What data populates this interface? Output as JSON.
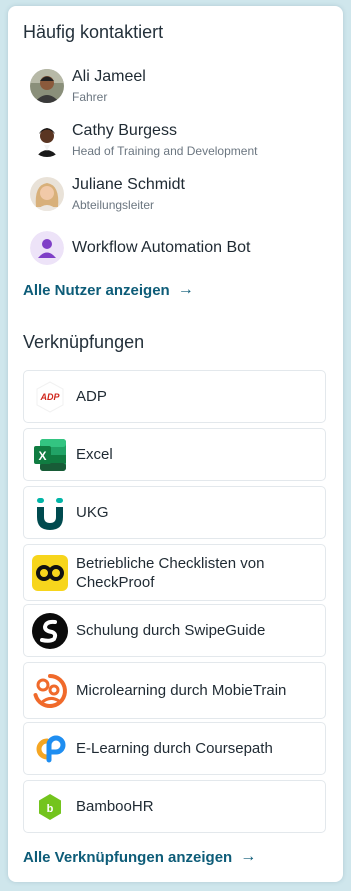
{
  "contacts_section": {
    "title": "Häufig kontaktiert",
    "contacts": [
      {
        "name": "Ali Jameel",
        "role": "Fahrer"
      },
      {
        "name": "Cathy Burgess",
        "role": "Head of Training and Development"
      },
      {
        "name": "Juliane Schmidt",
        "role": "Abteilungsleiter"
      },
      {
        "name": "Workflow Automation Bot",
        "role": ""
      }
    ],
    "view_all_label": "Alle Nutzer anzeigen",
    "arrow": "→"
  },
  "shortcuts_section": {
    "title": "Verknüpfungen",
    "items": [
      {
        "label": "ADP",
        "icon": "adp-logo-icon"
      },
      {
        "label": "Excel",
        "icon": "excel-logo-icon"
      },
      {
        "label": "UKG",
        "icon": "ukg-logo-icon"
      },
      {
        "label": "Betriebliche Checklisten von CheckProof",
        "icon": "checkproof-logo-icon"
      },
      {
        "label": "Schulung durch SwipeGuide",
        "icon": "swipeguide-logo-icon"
      },
      {
        "label": "Microlearning durch MobieTrain",
        "icon": "mobietrain-logo-icon"
      },
      {
        "label": "E-Learning durch Coursepath",
        "icon": "coursepath-logo-icon"
      },
      {
        "label": "BambooHR",
        "icon": "bamboohr-logo-icon"
      }
    ],
    "view_all_label": "Alle Verknüpfungen anzeigen",
    "arrow": "→"
  },
  "colors": {
    "background": "#cfe6ec",
    "link": "#0d5c78"
  }
}
